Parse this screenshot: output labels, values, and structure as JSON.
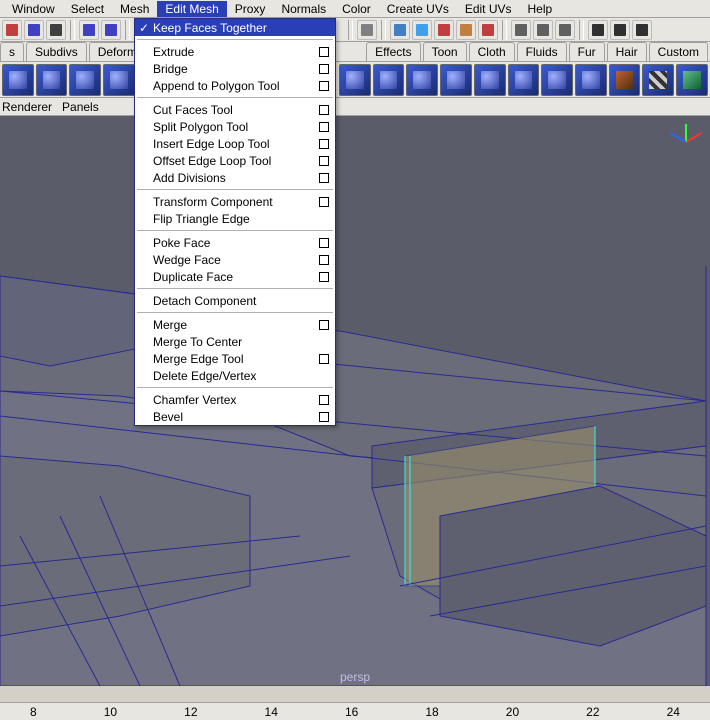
{
  "menubar": [
    {
      "label": "Window",
      "active": false
    },
    {
      "label": "Select",
      "active": false
    },
    {
      "label": "Mesh",
      "active": false
    },
    {
      "label": "Edit Mesh",
      "active": true
    },
    {
      "label": "Proxy",
      "active": false
    },
    {
      "label": "Normals",
      "active": false
    },
    {
      "label": "Color",
      "active": false
    },
    {
      "label": "Create UVs",
      "active": false
    },
    {
      "label": "Edit UVs",
      "active": false
    },
    {
      "label": "Help",
      "active": false
    }
  ],
  "shelf_tabs": [
    {
      "label": "s"
    },
    {
      "label": "Subdivs"
    },
    {
      "label": "Deformatio"
    },
    {
      "label": "Effects"
    },
    {
      "label": "Toon"
    },
    {
      "label": "Cloth"
    },
    {
      "label": "Fluids"
    },
    {
      "label": "Fur"
    },
    {
      "label": "Hair"
    },
    {
      "label": "Custom"
    }
  ],
  "panelbar": {
    "renderer": "Renderer",
    "panels": "Panels"
  },
  "dropdown": {
    "items": [
      {
        "label": "Keep Faces Together",
        "checked": true,
        "opt": false,
        "sel": true
      },
      {
        "sep": true
      },
      {
        "label": "Extrude",
        "opt": true
      },
      {
        "label": "Bridge",
        "opt": true
      },
      {
        "label": "Append to Polygon Tool",
        "opt": true
      },
      {
        "sep": true
      },
      {
        "label": "Cut Faces Tool",
        "opt": true
      },
      {
        "label": "Split Polygon Tool",
        "opt": true
      },
      {
        "label": "Insert Edge Loop Tool",
        "opt": true
      },
      {
        "label": "Offset Edge Loop Tool",
        "opt": true
      },
      {
        "label": "Add Divisions",
        "opt": true
      },
      {
        "sep": true
      },
      {
        "label": "Transform Component",
        "opt": true
      },
      {
        "label": "Flip Triangle Edge",
        "opt": false
      },
      {
        "sep": true
      },
      {
        "label": "Poke Face",
        "opt": true
      },
      {
        "label": "Wedge Face",
        "opt": true
      },
      {
        "label": "Duplicate Face",
        "opt": true
      },
      {
        "sep": true
      },
      {
        "label": "Detach Component",
        "opt": false
      },
      {
        "sep": true
      },
      {
        "label": "Merge",
        "opt": true
      },
      {
        "label": "Merge To Center",
        "opt": false
      },
      {
        "label": "Merge Edge Tool",
        "opt": true
      },
      {
        "label": "Delete Edge/Vertex",
        "opt": false
      },
      {
        "sep": true
      },
      {
        "label": "Chamfer Vertex",
        "opt": true
      },
      {
        "label": "Bevel",
        "opt": true
      }
    ]
  },
  "viewport": {
    "camera_label": "persp"
  },
  "timeline": {
    "frames": [
      "8",
      "10",
      "12",
      "14",
      "16",
      "18",
      "20",
      "22",
      "24"
    ]
  }
}
